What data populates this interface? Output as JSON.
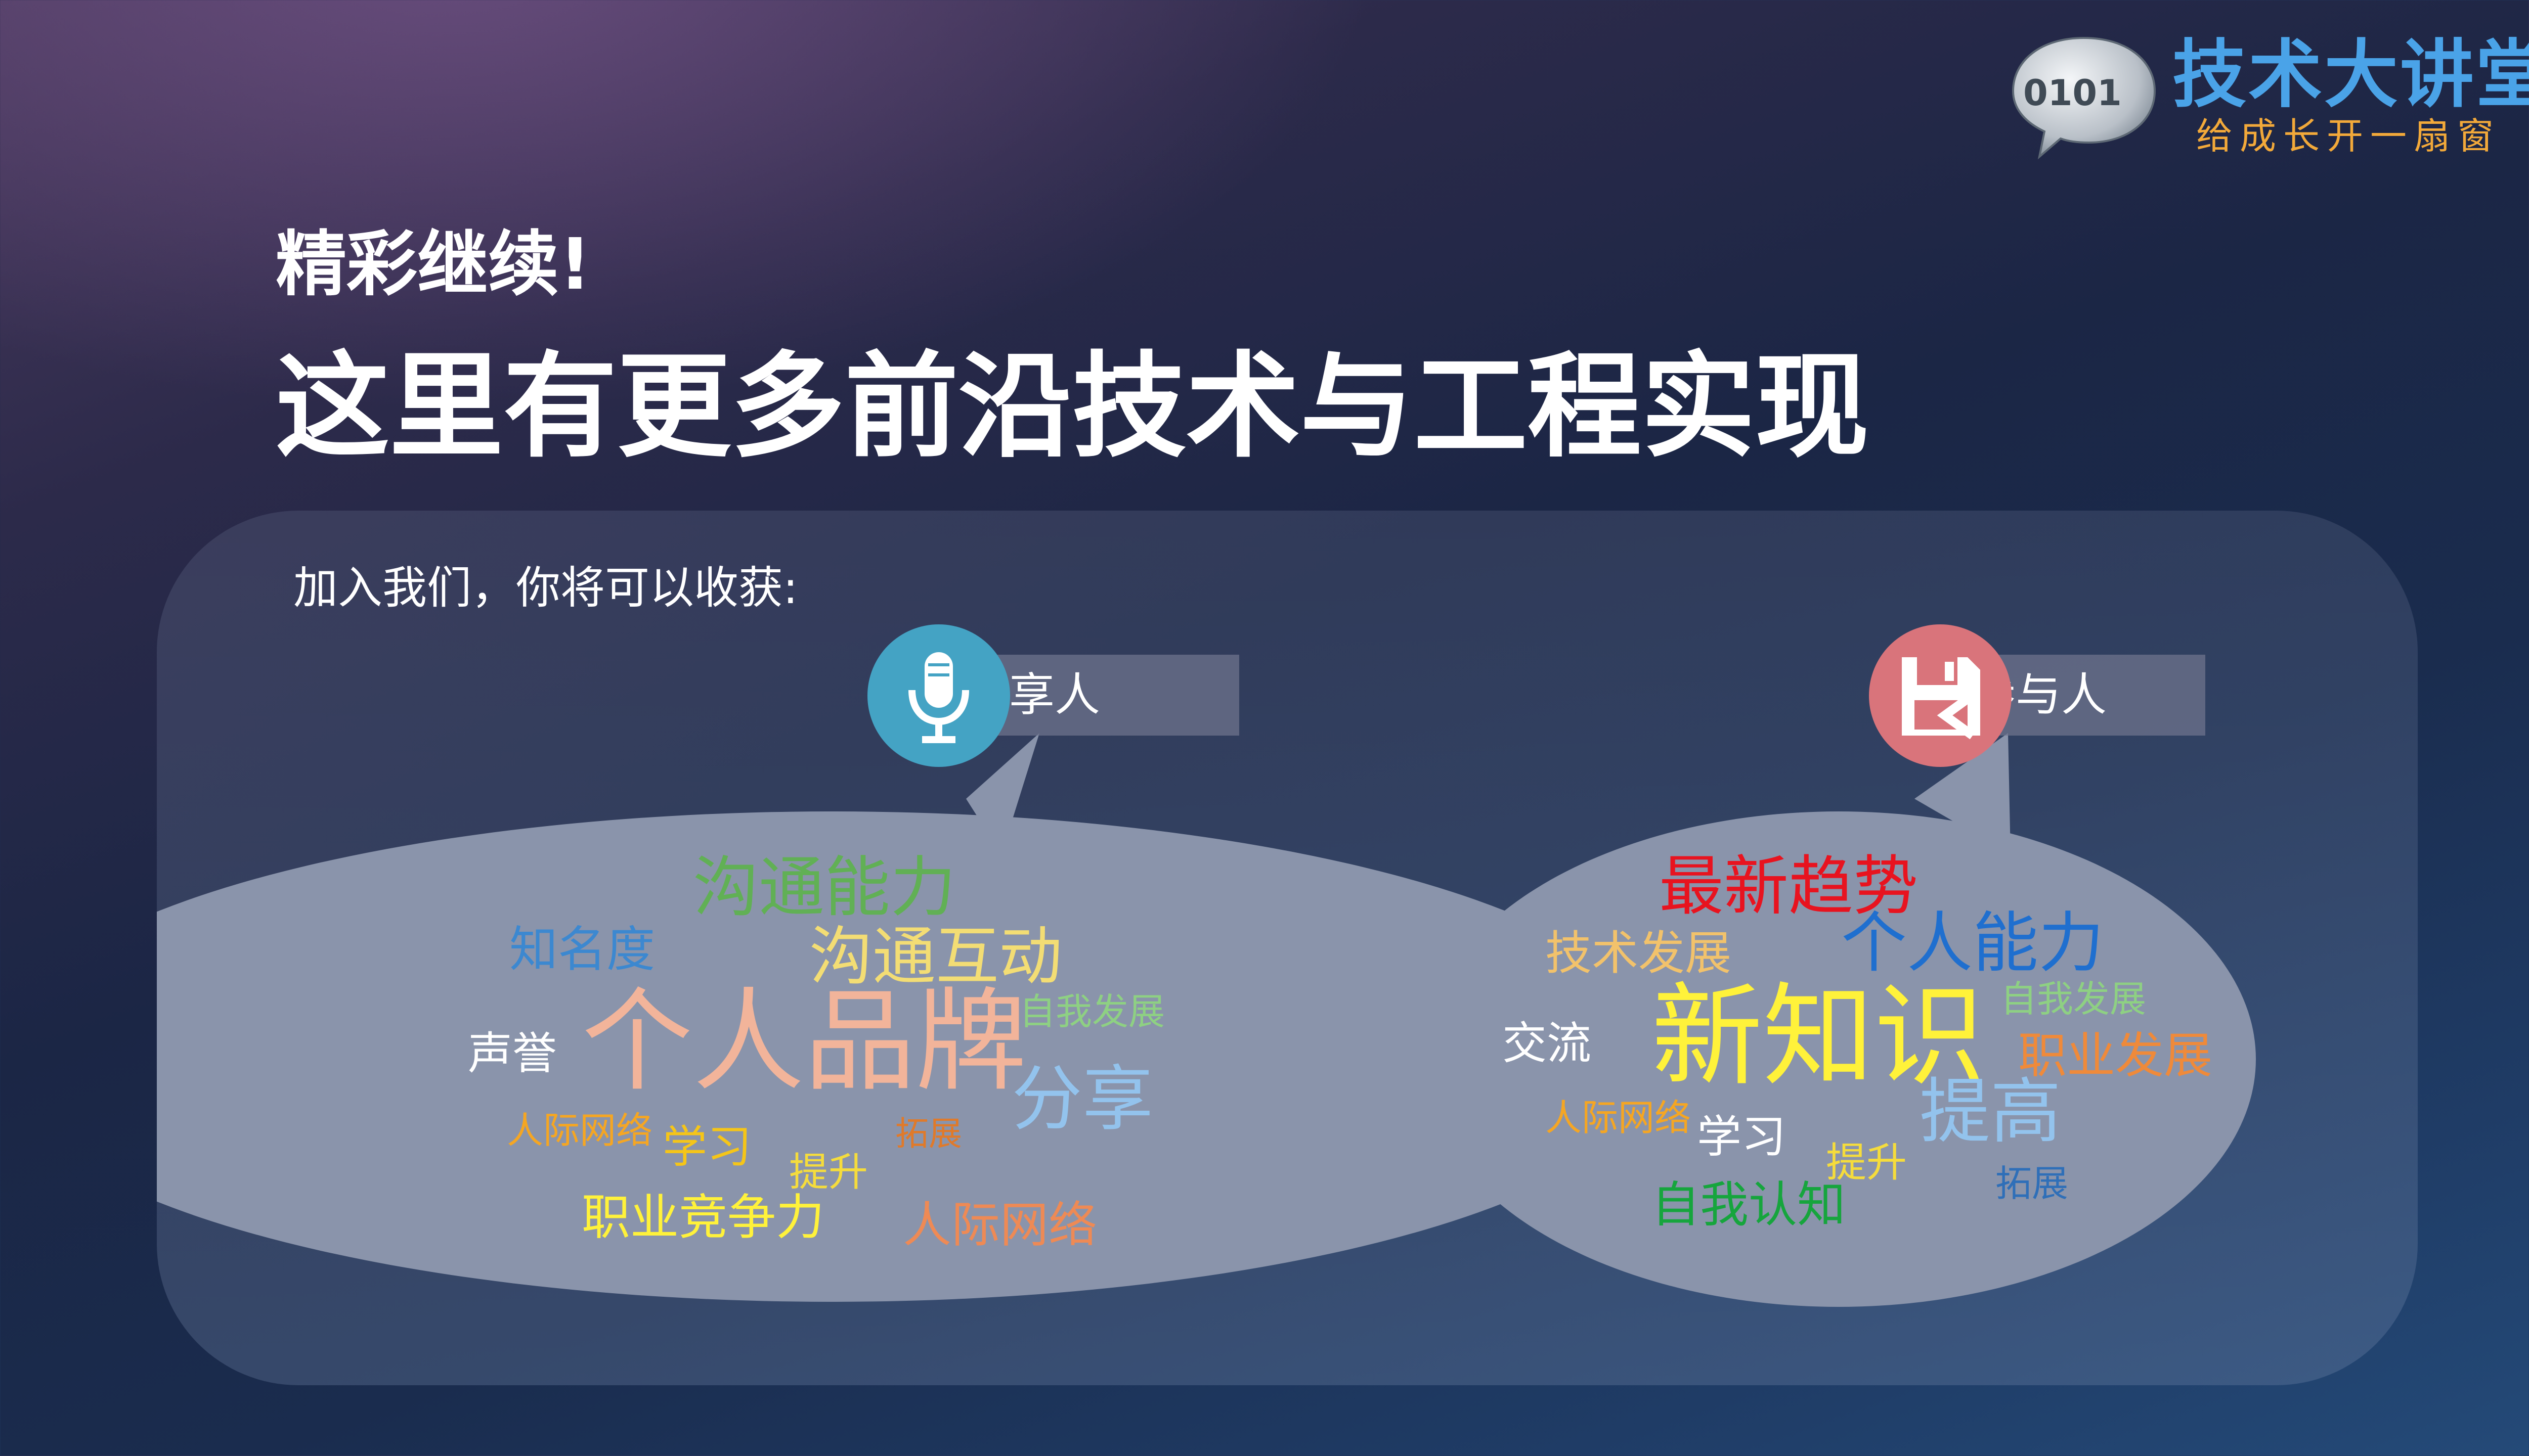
{
  "logo": {
    "bubble_text": "0101",
    "title": "技术大讲堂",
    "subtitle": "给成长开一扇窗"
  },
  "heading": {
    "subtitle": "精彩继续!",
    "title": "这里有更多前沿技术与工程实现"
  },
  "panel": {
    "label": "加入我们，你将可以收获:"
  },
  "sharer": {
    "label": "分享人",
    "icon": "microphone-icon",
    "color": "#44a3c4",
    "words": [
      "沟通能力",
      "知名度",
      "沟通互动",
      "个人品牌",
      "自我发展",
      "声誉",
      "分享",
      "人际网络",
      "学习",
      "拓展",
      "提升",
      "职业竞争力",
      "人际网络"
    ]
  },
  "participant": {
    "label": "参与人",
    "icon": "floppy-disk-icon",
    "color": "#d9747b",
    "words": [
      "最新趋势",
      "技术发展",
      "个人能力",
      "自我发展",
      "交流",
      "新知识",
      "职业发展",
      "人际网络",
      "提高",
      "学习",
      "提升",
      "自我认知",
      "拓展"
    ]
  }
}
